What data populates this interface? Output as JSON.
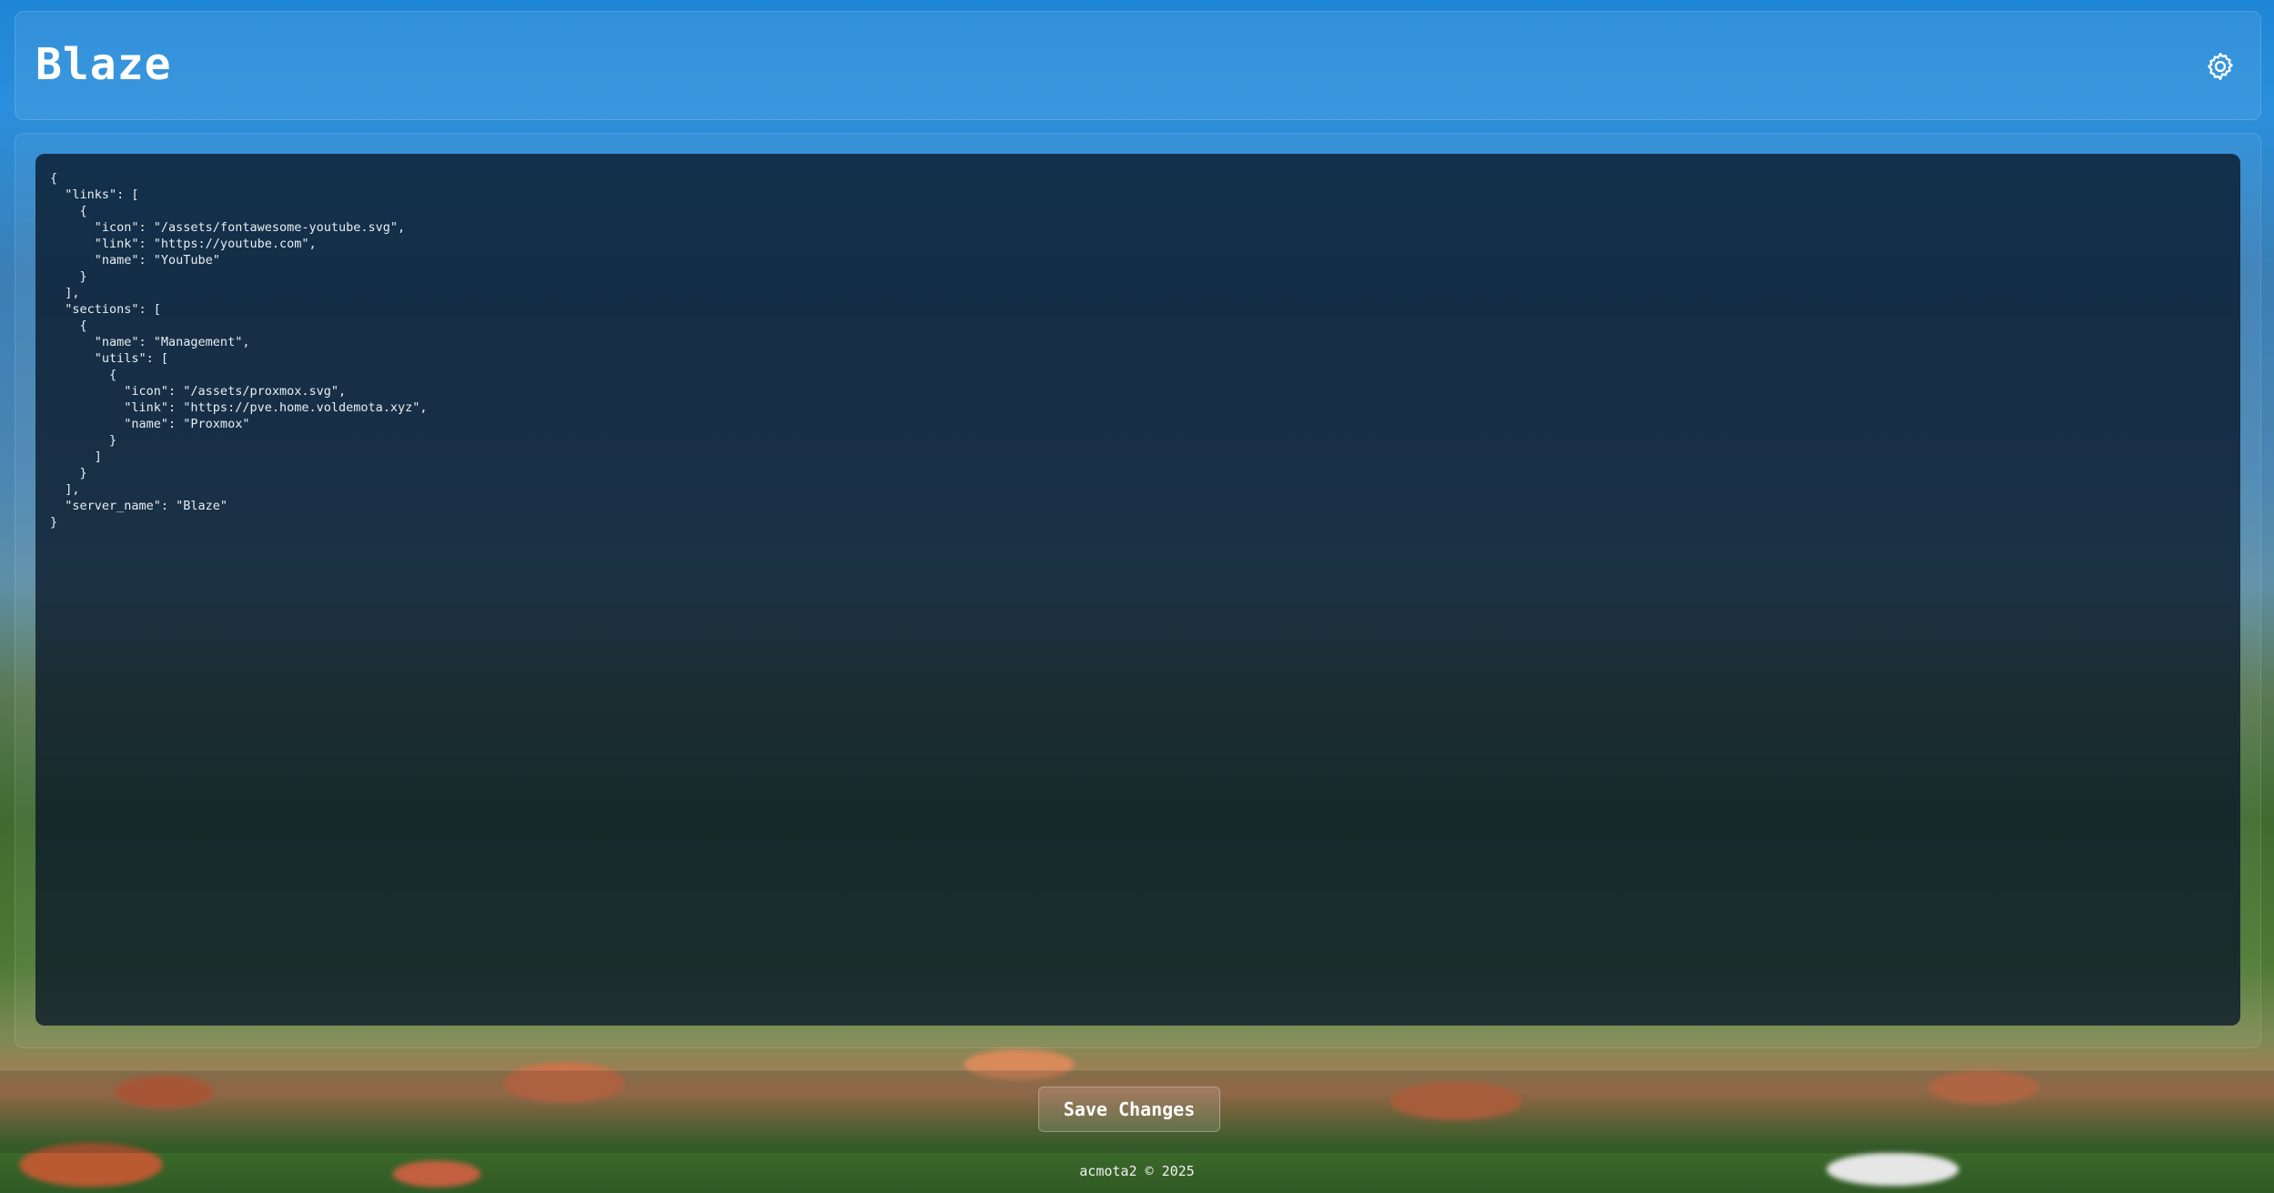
{
  "app": {
    "title": "Blaze",
    "settings_icon": "gear-icon"
  },
  "editor": {
    "content": "{\n  \"links\": [\n    {\n      \"icon\": \"/assets/fontawesome-youtube.svg\",\n      \"link\": \"https://youtube.com\",\n      \"name\": \"YouTube\"\n    }\n  ],\n  \"sections\": [\n    {\n      \"name\": \"Management\",\n      \"utils\": [\n        {\n          \"icon\": \"/assets/proxmox.svg\",\n          \"link\": \"https://pve.home.voldemota.xyz\",\n          \"name\": \"Proxmox\"\n        }\n      ]\n    }\n  ],\n  \"server_name\": \"Blaze\"\n}"
  },
  "actions": {
    "save_label": "Save Changes"
  },
  "footer": {
    "copyright": "acmota2 © 2025"
  }
}
